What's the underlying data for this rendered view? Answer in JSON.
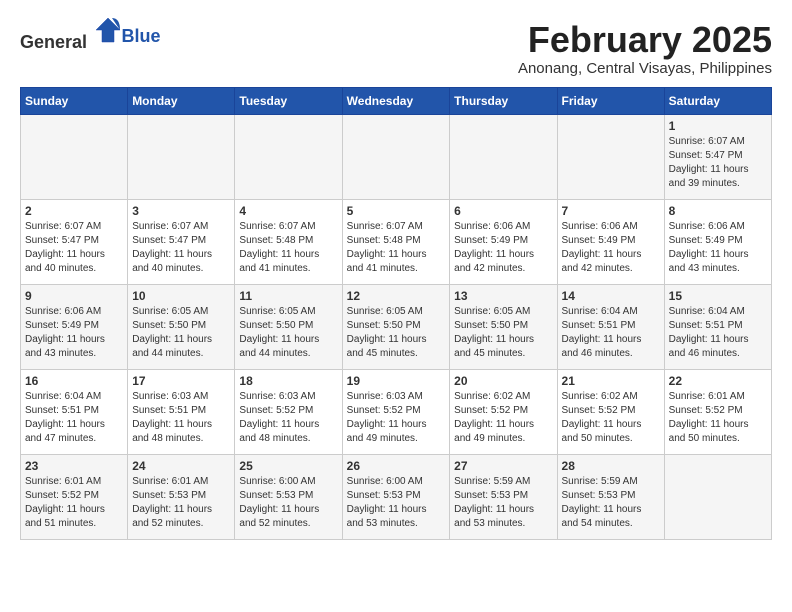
{
  "header": {
    "logo_general": "General",
    "logo_blue": "Blue",
    "month_title": "February 2025",
    "subtitle": "Anonang, Central Visayas, Philippines"
  },
  "weekdays": [
    "Sunday",
    "Monday",
    "Tuesday",
    "Wednesday",
    "Thursday",
    "Friday",
    "Saturday"
  ],
  "weeks": [
    [
      {
        "day": "",
        "info": ""
      },
      {
        "day": "",
        "info": ""
      },
      {
        "day": "",
        "info": ""
      },
      {
        "day": "",
        "info": ""
      },
      {
        "day": "",
        "info": ""
      },
      {
        "day": "",
        "info": ""
      },
      {
        "day": "1",
        "info": "Sunrise: 6:07 AM\nSunset: 5:47 PM\nDaylight: 11 hours\nand 39 minutes."
      }
    ],
    [
      {
        "day": "2",
        "info": "Sunrise: 6:07 AM\nSunset: 5:47 PM\nDaylight: 11 hours\nand 40 minutes."
      },
      {
        "day": "3",
        "info": "Sunrise: 6:07 AM\nSunset: 5:47 PM\nDaylight: 11 hours\nand 40 minutes."
      },
      {
        "day": "4",
        "info": "Sunrise: 6:07 AM\nSunset: 5:48 PM\nDaylight: 11 hours\nand 41 minutes."
      },
      {
        "day": "5",
        "info": "Sunrise: 6:07 AM\nSunset: 5:48 PM\nDaylight: 11 hours\nand 41 minutes."
      },
      {
        "day": "6",
        "info": "Sunrise: 6:06 AM\nSunset: 5:49 PM\nDaylight: 11 hours\nand 42 minutes."
      },
      {
        "day": "7",
        "info": "Sunrise: 6:06 AM\nSunset: 5:49 PM\nDaylight: 11 hours\nand 42 minutes."
      },
      {
        "day": "8",
        "info": "Sunrise: 6:06 AM\nSunset: 5:49 PM\nDaylight: 11 hours\nand 43 minutes."
      }
    ],
    [
      {
        "day": "9",
        "info": "Sunrise: 6:06 AM\nSunset: 5:49 PM\nDaylight: 11 hours\nand 43 minutes."
      },
      {
        "day": "10",
        "info": "Sunrise: 6:05 AM\nSunset: 5:50 PM\nDaylight: 11 hours\nand 44 minutes."
      },
      {
        "day": "11",
        "info": "Sunrise: 6:05 AM\nSunset: 5:50 PM\nDaylight: 11 hours\nand 44 minutes."
      },
      {
        "day": "12",
        "info": "Sunrise: 6:05 AM\nSunset: 5:50 PM\nDaylight: 11 hours\nand 45 minutes."
      },
      {
        "day": "13",
        "info": "Sunrise: 6:05 AM\nSunset: 5:50 PM\nDaylight: 11 hours\nand 45 minutes."
      },
      {
        "day": "14",
        "info": "Sunrise: 6:04 AM\nSunset: 5:51 PM\nDaylight: 11 hours\nand 46 minutes."
      },
      {
        "day": "15",
        "info": "Sunrise: 6:04 AM\nSunset: 5:51 PM\nDaylight: 11 hours\nand 46 minutes."
      }
    ],
    [
      {
        "day": "16",
        "info": "Sunrise: 6:04 AM\nSunset: 5:51 PM\nDaylight: 11 hours\nand 47 minutes."
      },
      {
        "day": "17",
        "info": "Sunrise: 6:03 AM\nSunset: 5:51 PM\nDaylight: 11 hours\nand 48 minutes."
      },
      {
        "day": "18",
        "info": "Sunrise: 6:03 AM\nSunset: 5:52 PM\nDaylight: 11 hours\nand 48 minutes."
      },
      {
        "day": "19",
        "info": "Sunrise: 6:03 AM\nSunset: 5:52 PM\nDaylight: 11 hours\nand 49 minutes."
      },
      {
        "day": "20",
        "info": "Sunrise: 6:02 AM\nSunset: 5:52 PM\nDaylight: 11 hours\nand 49 minutes."
      },
      {
        "day": "21",
        "info": "Sunrise: 6:02 AM\nSunset: 5:52 PM\nDaylight: 11 hours\nand 50 minutes."
      },
      {
        "day": "22",
        "info": "Sunrise: 6:01 AM\nSunset: 5:52 PM\nDaylight: 11 hours\nand 50 minutes."
      }
    ],
    [
      {
        "day": "23",
        "info": "Sunrise: 6:01 AM\nSunset: 5:52 PM\nDaylight: 11 hours\nand 51 minutes."
      },
      {
        "day": "24",
        "info": "Sunrise: 6:01 AM\nSunset: 5:53 PM\nDaylight: 11 hours\nand 52 minutes."
      },
      {
        "day": "25",
        "info": "Sunrise: 6:00 AM\nSunset: 5:53 PM\nDaylight: 11 hours\nand 52 minutes."
      },
      {
        "day": "26",
        "info": "Sunrise: 6:00 AM\nSunset: 5:53 PM\nDaylight: 11 hours\nand 53 minutes."
      },
      {
        "day": "27",
        "info": "Sunrise: 5:59 AM\nSunset: 5:53 PM\nDaylight: 11 hours\nand 53 minutes."
      },
      {
        "day": "28",
        "info": "Sunrise: 5:59 AM\nSunset: 5:53 PM\nDaylight: 11 hours\nand 54 minutes."
      },
      {
        "day": "",
        "info": ""
      }
    ]
  ]
}
